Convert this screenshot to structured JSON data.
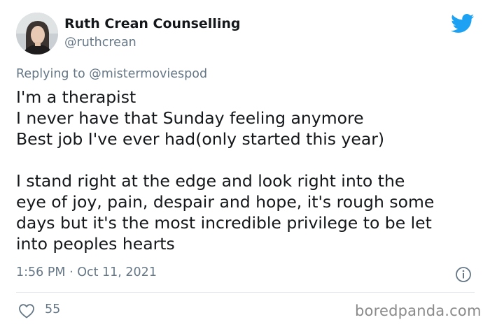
{
  "author": {
    "display_name": "Ruth Crean Counselling",
    "handle": "@ruthcrean",
    "avatar_icon": "profile-photo"
  },
  "reply": {
    "prefix": "Replying to ",
    "mention": "@mistermoviespod"
  },
  "tweet": {
    "lines": [
      "I'm a therapist",
      "I never have that Sunday feeling anymore",
      "Best job I've ever had(only started this year)",
      "",
      "I stand right at the edge and look right into the",
      "eye of joy, pain, despair and hope, it's rough some",
      "days but it's the most incredible privilege to be let",
      "into peoples hearts"
    ]
  },
  "meta": {
    "timestamp": "1:56 PM · Oct 11, 2021",
    "likes": "55"
  },
  "icons": {
    "brand": "twitter-bird-icon",
    "info": "info-icon",
    "like": "heart-icon"
  },
  "colors": {
    "twitter_blue": "#1da1f2",
    "secondary_text": "#657786",
    "primary_text": "#14171a",
    "divider": "#e1e8ed"
  },
  "watermark": "boredpanda.com"
}
